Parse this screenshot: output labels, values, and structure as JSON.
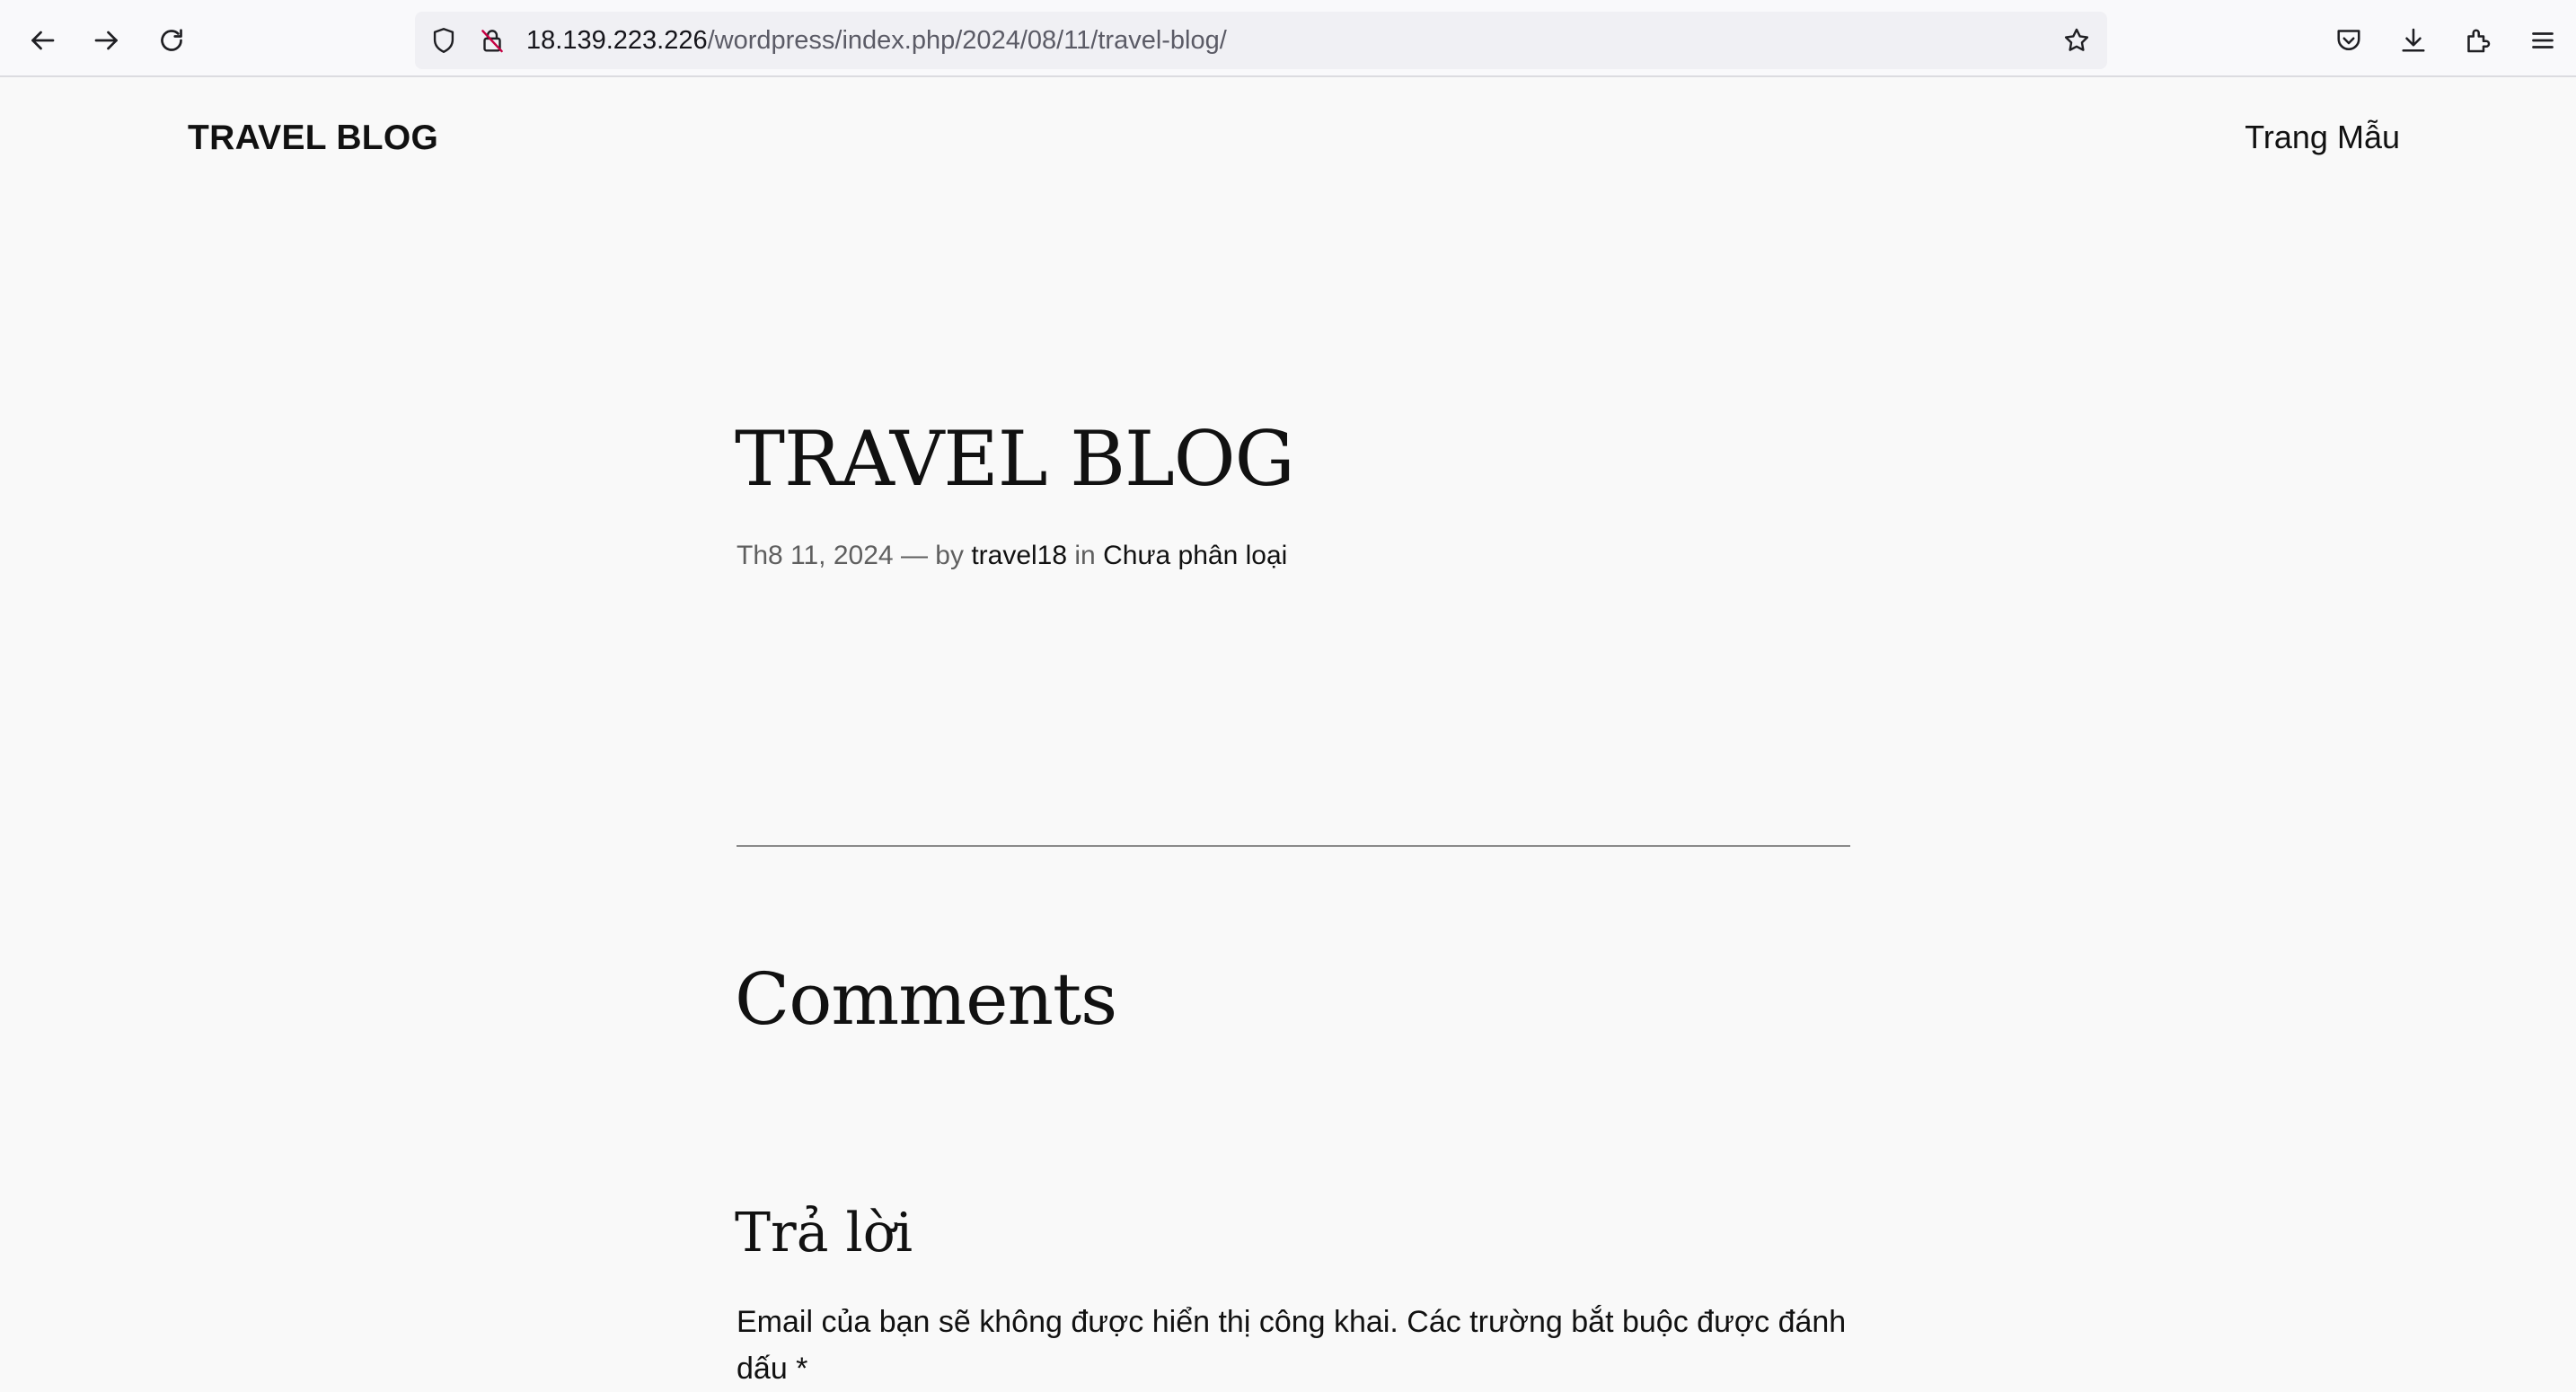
{
  "browser": {
    "url_host": "18.139.223.226",
    "url_path": "/wordpress/index.php/2024/08/11/travel-blog/",
    "icons": {
      "back": "back-arrow-icon",
      "forward": "forward-arrow-icon",
      "reload": "reload-icon",
      "shield": "tracking-protection-shield-icon",
      "insecure": "insecure-connection-lock-icon",
      "bookmark": "bookmark-star-icon",
      "pocket": "pocket-icon",
      "downloads": "download-icon",
      "extensions": "extensions-puzzle-icon",
      "menu": "hamburger-menu-icon"
    }
  },
  "site": {
    "title": "TRAVEL BLOG",
    "nav": [
      "Trang Mẫu"
    ]
  },
  "post": {
    "title": "TRAVEL BLOG",
    "date": "Th8 11, 2024",
    "separator": "—",
    "by_label": "by",
    "author": "travel18",
    "in_label": "in",
    "category": "Chưa phân loại"
  },
  "comments": {
    "heading": "Comments",
    "reply_heading": "Trả lời",
    "notes": "Email của bạn sẽ không được hiển thị công khai. Các trường bắt buộc được đánh dấu *"
  },
  "colors": {
    "page_background": "#f9f9f9",
    "text": "#111111",
    "muted_text": "#5f5f5f",
    "url_bar_background": "#f0f0f4",
    "insecure_accent": "#c50042"
  }
}
